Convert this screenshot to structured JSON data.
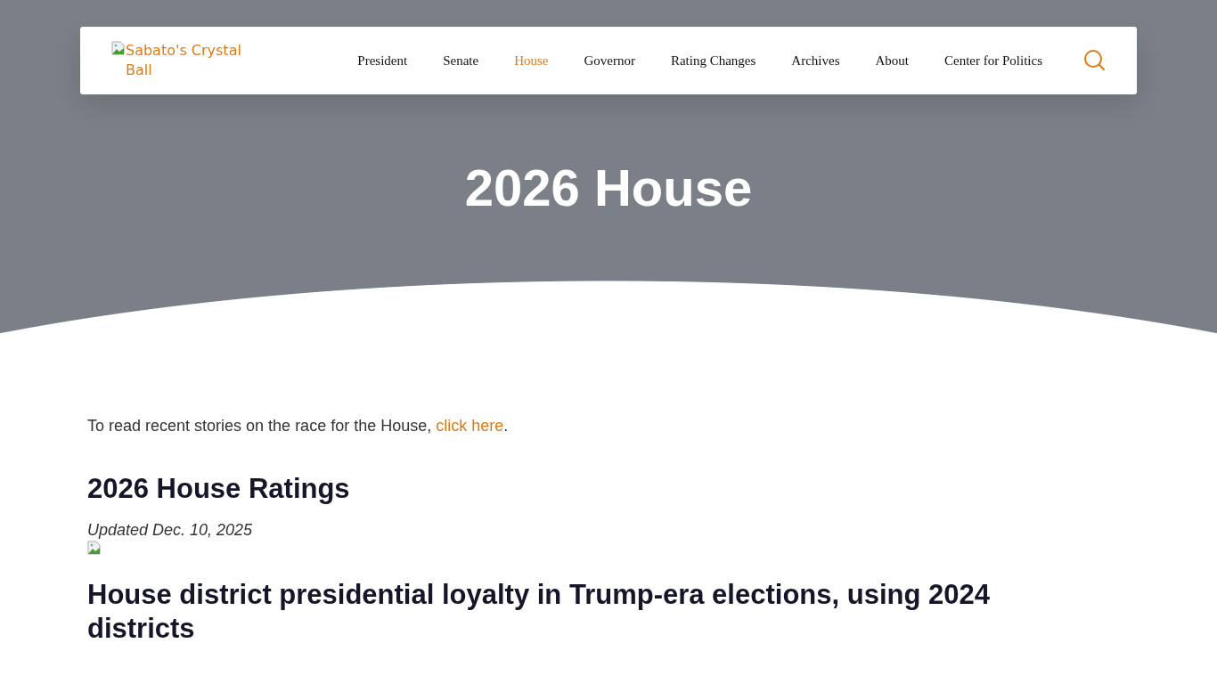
{
  "header": {
    "logo_alt": "Sabato's Crystal Ball",
    "nav": [
      {
        "label": "President",
        "selected": false
      },
      {
        "label": "Senate",
        "selected": false
      },
      {
        "label": "House",
        "selected": true
      },
      {
        "label": "Governor",
        "selected": false
      },
      {
        "label": "Rating Changes",
        "selected": false
      },
      {
        "label": "Archives",
        "selected": false
      },
      {
        "label": "About",
        "selected": false
      },
      {
        "label": "Center for Politics",
        "selected": false
      }
    ]
  },
  "hero": {
    "title": "2026 House"
  },
  "content": {
    "intro": {
      "text": "To read recent stories on the race for the House, ",
      "link": "click here",
      "after": "."
    },
    "ratings_heading": "2026 House Ratings",
    "updated": "Updated Dec. 10, 2025",
    "loyalty_heading": "House district presidential loyalty in Trump-era elections, using 2024 districts"
  }
}
